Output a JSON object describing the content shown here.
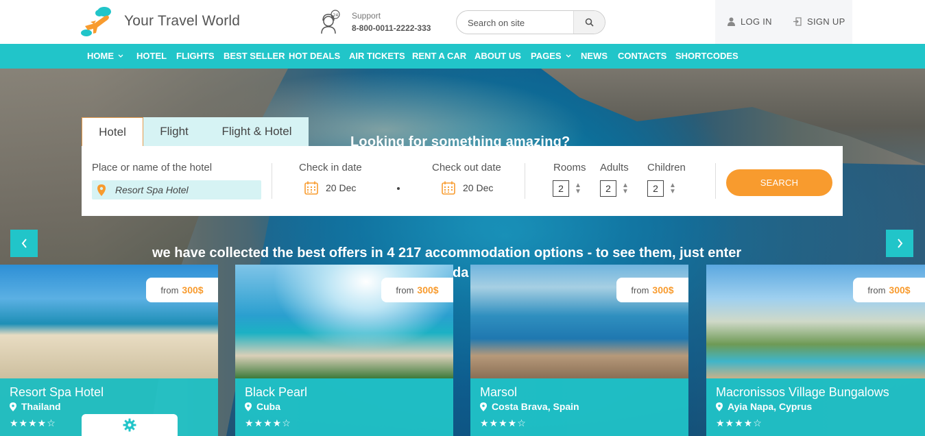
{
  "header": {
    "logo_text": "Your Travel World",
    "support_label": "Support",
    "support_phone": "8-800-0011-2222-333",
    "search_placeholder": "Search on site",
    "login_label": "LOG IN",
    "signup_label": "SIGN UP"
  },
  "nav": {
    "items": [
      {
        "label": "HOME",
        "dropdown": true
      },
      {
        "label": "HOTEL"
      },
      {
        "label": "FLIGHTS"
      },
      {
        "label": "BEST SELLER"
      },
      {
        "label": "HOT DEALS"
      },
      {
        "label": "AIR TICKETS"
      },
      {
        "label": "RENT A CAR"
      },
      {
        "label": "ABOUT US"
      },
      {
        "label": "PAGES",
        "dropdown": true
      },
      {
        "label": "NEWS"
      },
      {
        "label": "CONTACTS"
      },
      {
        "label": "SHORTCODES"
      }
    ]
  },
  "hero": {
    "title": "Looking for something amazing?",
    "subtitle": "we have collected the best offers in 4 217 accommodation options - to see them, just enter",
    "subtitle_tail": "da"
  },
  "search": {
    "tabs": [
      "Hotel",
      "Flight",
      "Flight & Hotel"
    ],
    "active_tab": "Hotel",
    "place_label": "Place or name of the hotel",
    "place_value": "Resort Spa Hotel",
    "checkin_label": "Check in date",
    "checkin_value": "20 Dec",
    "checkout_label": "Check out date",
    "checkout_value": "20 Dec",
    "rooms_label": "Rooms",
    "rooms_value": "2",
    "adults_label": "Adults",
    "adults_value": "2",
    "children_label": "Children",
    "children_value": "2",
    "submit_label": "SEARCH"
  },
  "cards": [
    {
      "name": "Resort Spa Hotel",
      "location": "Thailand",
      "price_prefix": "from",
      "price": "300$",
      "stars": "★★★★☆"
    },
    {
      "name": "Black Pearl",
      "location": "Cuba",
      "price_prefix": "from",
      "price": "300$",
      "stars": "★★★★☆"
    },
    {
      "name": "Marsol",
      "location": "Costa Brava, Spain",
      "price_prefix": "from",
      "price": "300$",
      "stars": "★★★★☆"
    },
    {
      "name": "Macronissos Village Bungalows",
      "location": "Ayia Napa, Cyprus",
      "price_prefix": "from",
      "price": "300$",
      "stars": "★★★★☆"
    }
  ],
  "colors": {
    "accent": "#21c5c9",
    "orange": "#f89b2e",
    "text": "#555555"
  }
}
